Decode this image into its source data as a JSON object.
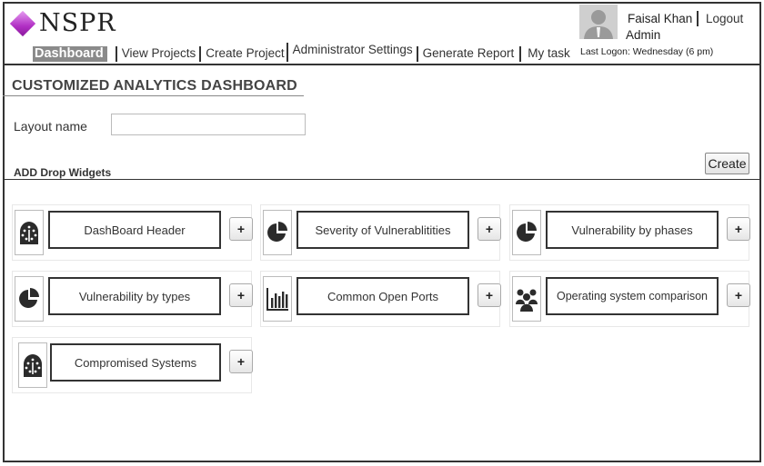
{
  "app": {
    "logo_text": "NSPR",
    "brand_color": "#b12fc4"
  },
  "nav": {
    "items": [
      {
        "label": "Dashboard",
        "active": true
      },
      {
        "label": "View Projects"
      },
      {
        "label": "Create Project"
      },
      {
        "label": "Administrator Settings"
      },
      {
        "label": "Generate Report"
      },
      {
        "label": "My task"
      }
    ]
  },
  "user": {
    "name": "Faisal Khan",
    "logout_label": "Logout",
    "role": "Admin",
    "last_logon": "Last Logon:  Wednesday (6 pm)"
  },
  "page": {
    "title": "CUSTOMIZED ANALYTICS DASHBOARD",
    "layout_label": "Layout name",
    "layout_value": "",
    "layout_placeholder": "",
    "add_widgets_label": "ADD Drop Widgets",
    "create_label": "Create"
  },
  "widgets": [
    {
      "label": "DashBoard Header",
      "icon": "dashboard-gauge-icon",
      "add_label": "+"
    },
    {
      "label": "Severity of Vulnerablitities",
      "icon": "pie-chart-icon",
      "add_label": "+"
    },
    {
      "label": "Vulnerability by phases",
      "icon": "pie-chart-icon",
      "add_label": "+"
    },
    {
      "label": "Vulnerability by types",
      "icon": "pie-chart-icon",
      "add_label": "+"
    },
    {
      "label": "Common Open Ports",
      "icon": "bar-chart-icon",
      "add_label": "+"
    },
    {
      "label": "Operating system comparison",
      "icon": "users-group-icon",
      "add_label": "+"
    },
    {
      "label": "Compromised Systems",
      "icon": "dashboard-gauge-icon",
      "add_label": "+"
    }
  ]
}
